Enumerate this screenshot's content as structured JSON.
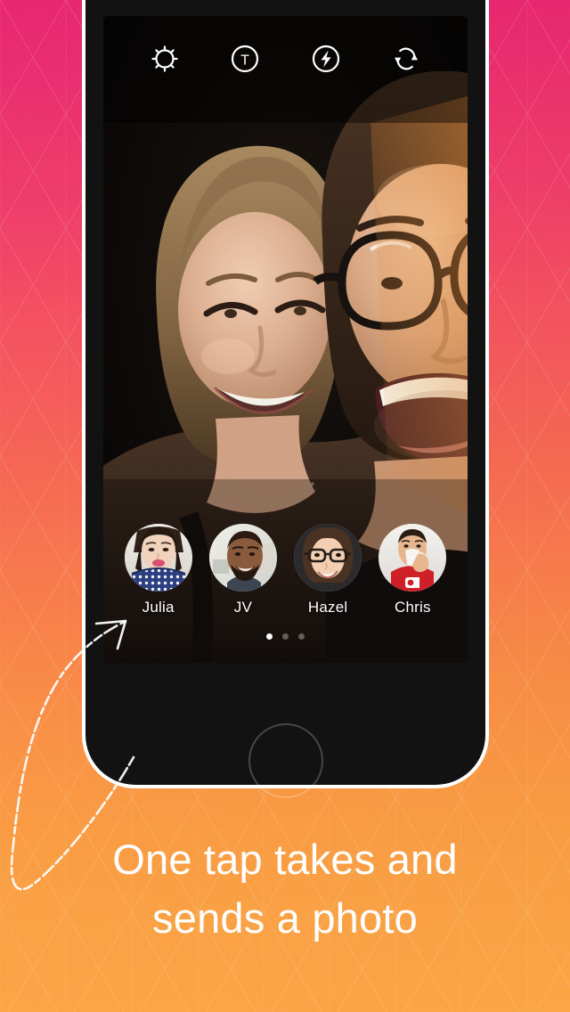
{
  "theme": {
    "gradient_top": "#e8246f",
    "gradient_mid": "#f66454",
    "gradient_bottom": "#fda747",
    "accent_white": "#ffffff",
    "phone_body": "#121212",
    "screen_bg": "#0a0a0a"
  },
  "phone": {
    "device": "smartphone-mockup",
    "home_button_label": "home-button"
  },
  "camera": {
    "toolbar": [
      {
        "name": "settings-icon",
        "label": "Settings"
      },
      {
        "name": "text-icon",
        "label": "T"
      },
      {
        "name": "flash-icon",
        "label": "Flash"
      },
      {
        "name": "flip-camera-icon",
        "label": "Flip camera"
      }
    ],
    "viewfinder_alt": "Selfie of a smiling blonde woman and a laughing man wearing glasses at night",
    "contacts": [
      {
        "name": "Julia",
        "avatar_alt": "Woman with blue polka-dot scarf"
      },
      {
        "name": "JV",
        "avatar_alt": "Smiling man with beard"
      },
      {
        "name": "Hazel",
        "avatar_alt": "Woman with dark glasses and bob haircut"
      },
      {
        "name": "Chris",
        "avatar_alt": "Man in red shirt drinking from a white mug"
      }
    ],
    "pager": {
      "total": 3,
      "active_index": 0
    }
  },
  "annotation": {
    "arrow_name": "curved-arrow-pointing-to-contact"
  },
  "caption": {
    "line1": "One tap takes and",
    "line2": "sends a photo"
  }
}
